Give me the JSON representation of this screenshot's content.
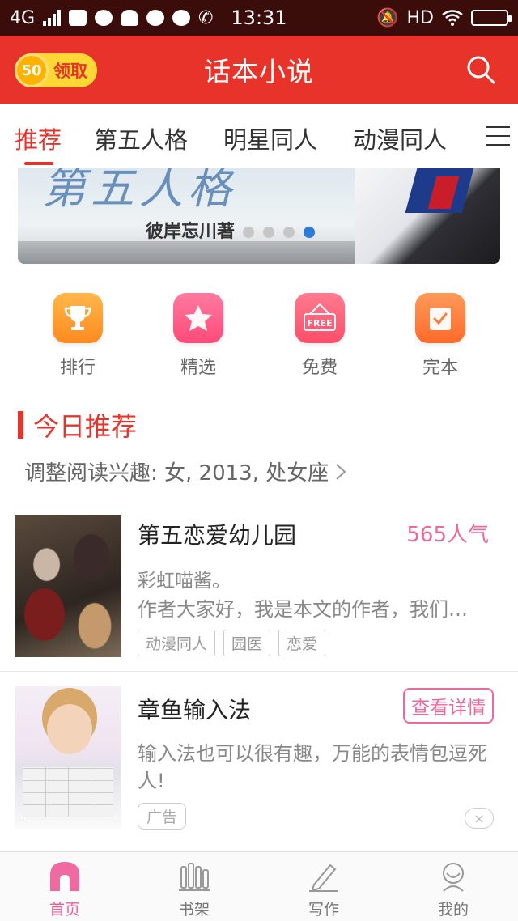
{
  "status_bar": {
    "network": "4G",
    "time": "13:31",
    "hd": "HD",
    "icons": [
      "signal-icon",
      "sim-icon",
      "message-icon",
      "cloud-icon",
      "wechat-icon",
      "browser-icon",
      "missed-call-icon",
      "mute-icon",
      "wifi-icon",
      "battery-icon"
    ]
  },
  "header": {
    "coin_value": "50",
    "coin_label": "领取",
    "title": "话本小说",
    "accent_color": "#e8332b"
  },
  "tabs": {
    "items": [
      "推荐",
      "第五人格",
      "明星同人",
      "动漫同人"
    ],
    "active_index": 0
  },
  "banner": {
    "title_art": "第五人格",
    "author": "彼岸忘川著",
    "slide_count": 4,
    "active_slide": 3
  },
  "categories": [
    {
      "label": "排行",
      "icon": "trophy-icon",
      "color": "#ff9a2e"
    },
    {
      "label": "精选",
      "icon": "star-icon",
      "color": "#ff5a8a"
    },
    {
      "label": "免费",
      "icon": "free-icon",
      "color": "#ff5f7c"
    },
    {
      "label": "完本",
      "icon": "check-icon",
      "color": "#ff7a3c"
    }
  ],
  "section": {
    "title": "今日推荐",
    "interest": "调整阅读兴趣: 女, 2013, 处女座"
  },
  "books": [
    {
      "title": "第五恋爱幼儿园",
      "popularity": "565人气",
      "author": "彩虹喵酱。",
      "description": "作者大家好，我是本文的作者，我们…",
      "tags": [
        "动漫同人",
        "园医",
        "恋爱"
      ]
    }
  ],
  "ad": {
    "title": "章鱼输入法",
    "button": "查看详情",
    "description": "输入法也可以很有趣，万能的表情包逗死人!",
    "tag": "广告",
    "close": "×"
  },
  "bottom_nav": [
    {
      "label": "首页",
      "icon": "home-icon",
      "active": true
    },
    {
      "label": "书架",
      "icon": "bookshelf-icon",
      "active": false
    },
    {
      "label": "写作",
      "icon": "pen-icon",
      "active": false
    },
    {
      "label": "我的",
      "icon": "profile-icon",
      "active": false
    }
  ]
}
